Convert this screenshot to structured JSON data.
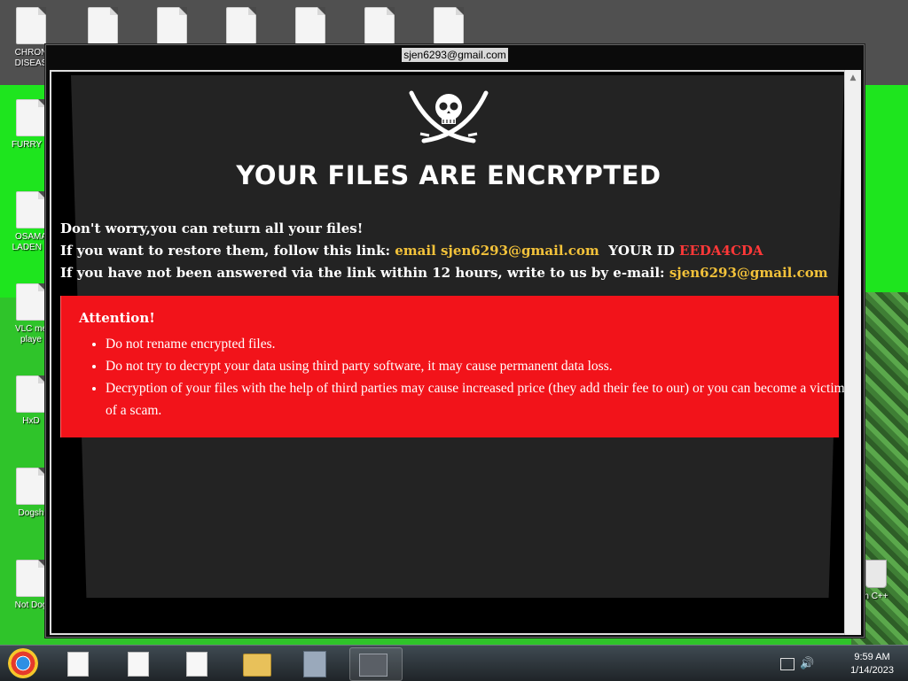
{
  "desktop": {
    "icons": [
      {
        "label": "CHRON DISEAS"
      },
      {
        "label": ""
      },
      {
        "label": ""
      },
      {
        "label": ""
      },
      {
        "label": ""
      },
      {
        "label": ""
      },
      {
        "label": ""
      },
      {
        "label": "FURRY C"
      },
      {
        "label": "OSAMA LADEN E"
      },
      {
        "label": "VLC me playe"
      },
      {
        "label": "HxD"
      },
      {
        "label": "Dogsh"
      },
      {
        "label": "Not Dog"
      },
      {
        "label": "n C++"
      }
    ]
  },
  "window": {
    "title": "sjen6293@gmail.com"
  },
  "note": {
    "headline": "YOUR FILES ARE ENCRYPTED",
    "line1": "Don't worry,you can return all your files!",
    "line2_prefix": "If you want to restore them, follow this link: ",
    "line2_link": "email sjen6293@gmail.com",
    "line2_id_label": "YOUR ID",
    "line2_id_value": "EEDA4CDA",
    "line3_prefix": "If you have not been answered via the link within 12 hours, write to us by e-mail: ",
    "line3_email": "sjen6293@gmail.com",
    "attention_title": "Attention!",
    "attention_items": [
      "Do not rename encrypted files.",
      "Do not try to decrypt your data using third party software, it may cause permanent data loss.",
      "Decryption of your files with the help of third parties may cause increased price (they add their fee to our) or you can become a victim of a scam."
    ],
    "colors": {
      "highlight_gold": "#f3c23a",
      "id_red": "#ff3838",
      "attention_bg": "#f2131a"
    },
    "logo": "skull-and-crossed-swords-icon"
  },
  "taskbar": {
    "start_icon": "chrome-start-orb-icon",
    "items": [
      "document-icon",
      "document-icon",
      "document-icon",
      "file-explorer-icon",
      "setup-icon",
      "window-app-icon"
    ],
    "time": "9:59 AM",
    "date": "1/14/2023",
    "tray_icons": [
      "network-icon",
      "volume-icon"
    ]
  }
}
